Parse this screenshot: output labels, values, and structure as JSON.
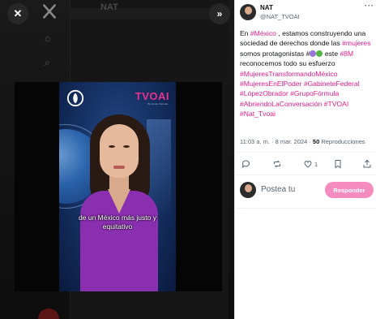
{
  "viewer": {
    "close_icon": "close-icon",
    "expand_icon": "chevrons-right-icon",
    "video": {
      "channel_logo_text": "TVOAI",
      "channel_logo_subtext": "By Grupo Fórmula",
      "caption": "de un México más justo y equitativo"
    }
  },
  "tweet": {
    "author_name": "NAT",
    "author_handle": "@NAT_TVOAI",
    "more_icon": "···",
    "text_parts": {
      "p1": "En ",
      "h1": "#México",
      "p2": " , estamos construyendo una sociedad de derechos donde las ",
      "h2": "#mujeres",
      "p3": " somos protagonistas #",
      "p4": " este ",
      "h3": "#8M",
      "p5": " reconocemos todo su esfuerzo",
      "h4": "#MujeresTransformandoMéxico #MujeresEnElPoder #GabineteFederal #LópezObrador #GrupoFórmula #AbriendoLaConversación #TVOAI #Nat_Tvoai"
    },
    "timestamp": "11:03 a. m. · 8 mar. 2024 · ",
    "views_count": "50",
    "views_label": " Reproducciones",
    "like_count": "1",
    "reply_placeholder": "Postea tu",
    "reply_button": "Responder"
  },
  "colors": {
    "hashtag": "#e21d89",
    "reply_button": "#f58cc0",
    "caption": "#ffffff",
    "dress": "#8a2fb0"
  }
}
